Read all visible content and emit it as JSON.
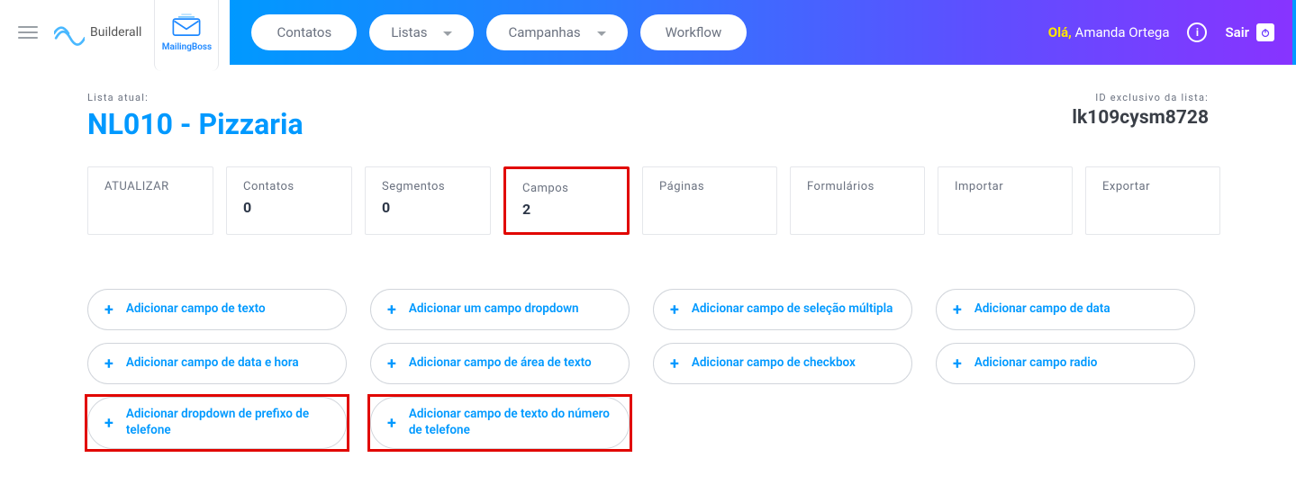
{
  "branding": {
    "name": "Builderall",
    "app_tab_label": "MailingBoss"
  },
  "nav": {
    "contacts": "Contatos",
    "lists": "Listas",
    "campaigns": "Campanhas",
    "workflow": "Workflow"
  },
  "user": {
    "greeting": "Olá,",
    "name": "Amanda Ortega",
    "logout": "Sair"
  },
  "page": {
    "current_list_label": "Lista atual:",
    "current_list_name": "NL010 - Pizzaria",
    "unique_id_label": "ID exclusivo da lista:",
    "unique_id_value": "lk109cysm8728"
  },
  "tabs": [
    {
      "key": "atualizar",
      "label": "ATUALIZAR",
      "count": null,
      "active": false
    },
    {
      "key": "contatos",
      "label": "Contatos",
      "count": "0",
      "active": false
    },
    {
      "key": "segmentos",
      "label": "Segmentos",
      "count": "0",
      "active": false
    },
    {
      "key": "campos",
      "label": "Campos",
      "count": "2",
      "active": true
    },
    {
      "key": "paginas",
      "label": "Páginas",
      "count": null,
      "active": false
    },
    {
      "key": "formularios",
      "label": "Formulários",
      "count": null,
      "active": false
    },
    {
      "key": "importar",
      "label": "Importar",
      "count": null,
      "active": false
    },
    {
      "key": "exportar",
      "label": "Exportar",
      "count": null,
      "active": false
    }
  ],
  "add_fields": {
    "text": "Adicionar campo de texto",
    "dropdown": "Adicionar um campo dropdown",
    "multiselect": "Adicionar campo de seleção múltipla",
    "date": "Adicionar campo de data",
    "datetime": "Adicionar campo de data e hora",
    "textarea": "Adicionar campo de área de texto",
    "checkbox": "Adicionar campo de checkbox",
    "radio": "Adicionar campo radio",
    "phone_prefix_dd": "Adicionar dropdown de prefixo de telefone",
    "phone_text": "Adicionar campo de texto do número de telefone"
  }
}
